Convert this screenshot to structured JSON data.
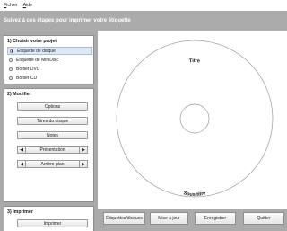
{
  "menu": {
    "file": "Fichier",
    "help": "Aide"
  },
  "header": {
    "title": "Suivez à ces étapes pour imprimer votre étiquette"
  },
  "step1": {
    "title": "1) Choisir votre projet",
    "options": [
      {
        "label": "Étiquette de disque",
        "selected": true
      },
      {
        "label": "Étiquette de MiniDisc",
        "selected": false
      },
      {
        "label": "Boîtier DVD",
        "selected": false
      },
      {
        "label": "Boîtier CD",
        "selected": false
      }
    ]
  },
  "step2": {
    "title": "2) Modifier",
    "options_button": "Options",
    "disc_titles_button": "Titres du disque",
    "notes_button": "Notes",
    "presentation_label": "Présentation",
    "background_label": "Arrière-plan",
    "prev_glyph": "◀",
    "next_glyph": "▶"
  },
  "step3": {
    "title": "3) Imprimer",
    "print_button": "Imprimer"
  },
  "disc": {
    "title_text": "Titre",
    "subtitle_text": "Sous-titre"
  },
  "bottom": {
    "labels_button": "Étiquettes/disques",
    "update_button": "Mise à jour",
    "save_button": "Enregistrer",
    "quit_button": "Quitter"
  },
  "colors": {
    "banner": "#ababab",
    "panel_bg": "#a9a9a9",
    "selection": "#dfe8f5"
  }
}
